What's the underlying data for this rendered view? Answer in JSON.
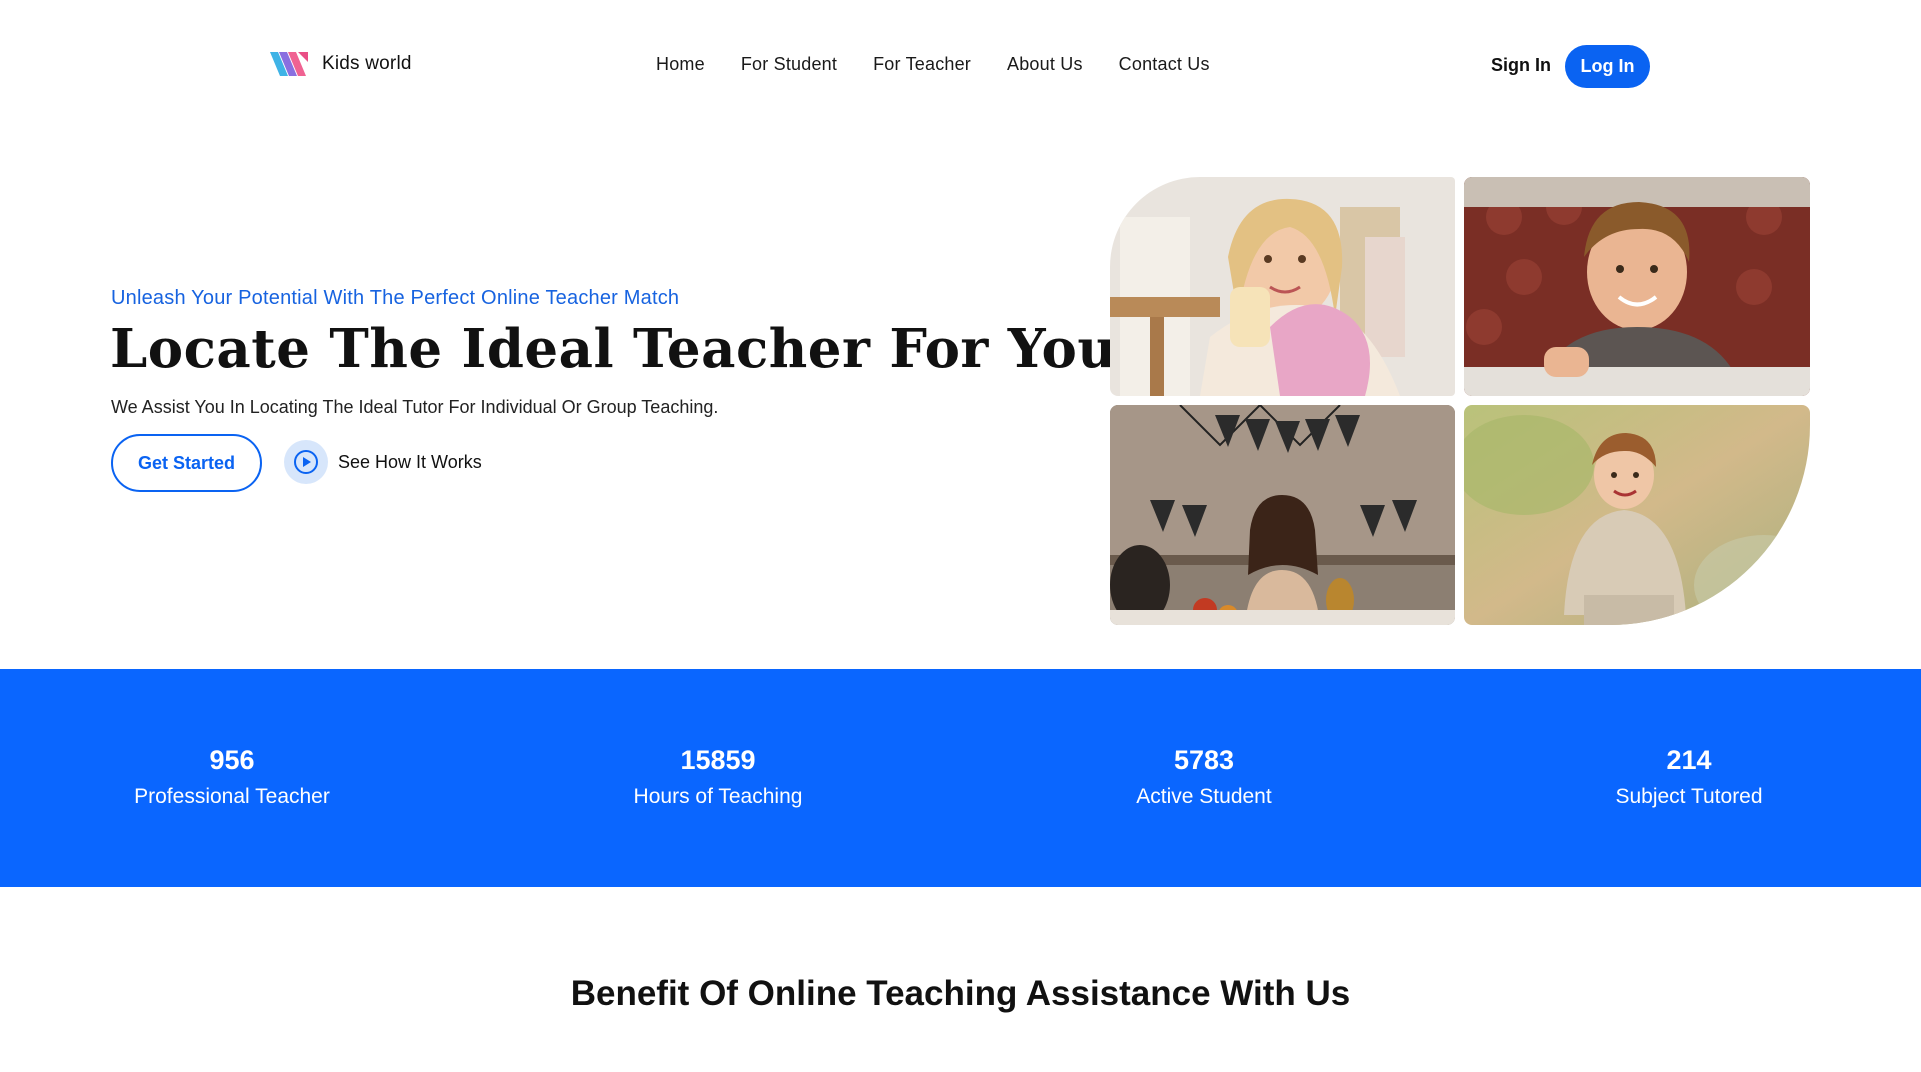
{
  "brand": {
    "name": "Kids world"
  },
  "nav": {
    "items": [
      "Home",
      "For Student",
      "For Teacher",
      "About Us",
      "Contact Us"
    ],
    "signin": "Sign In",
    "login": "Log In"
  },
  "hero": {
    "tagline": "Unleash Your Potential With The Perfect Online Teacher Match",
    "title": "Locate The Ideal Teacher For Your Kid",
    "subtitle": "We Assist You In Locating The Ideal Tutor For Individual Or Group Teaching.",
    "cta_primary": "Get Started",
    "cta_secondary": "See How It Works"
  },
  "stats": [
    {
      "value": "956",
      "label": "Professional Teacher"
    },
    {
      "value": "15859",
      "label": "Hours of Teaching"
    },
    {
      "value": "5783",
      "label": "Active Student"
    },
    {
      "value": "214",
      "label": "Subject Tutored"
    }
  ],
  "benefits": {
    "title": "Benefit Of Online Teaching Assistance With Us"
  },
  "colors": {
    "accent": "#0a63f2",
    "band": "#0a66ff",
    "tagline": "#1763e0"
  },
  "icons": {
    "play": "play-circle-icon",
    "logo": "brand-logo-icon"
  }
}
